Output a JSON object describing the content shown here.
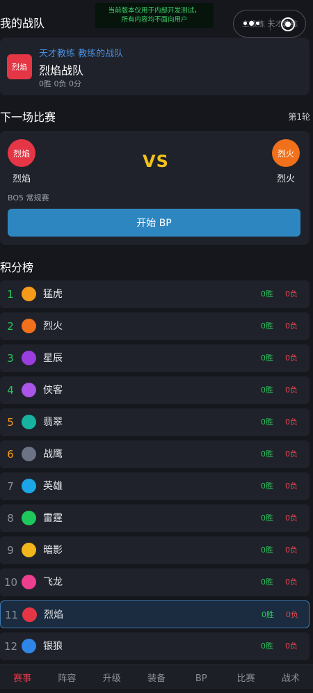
{
  "notice": {
    "line1": "当前版本仅用于内部开发测试，",
    "line2": "所有内容均不面向用户"
  },
  "capsule": {
    "tabs_text": "主教练 天才教练"
  },
  "my_team": {
    "section_title": "我的战队",
    "logo_text": "烈焰",
    "logo_color": "#e53646",
    "coach_line": "天才教练 教练的战队",
    "team_name": "烈焰战队",
    "stats": "0胜 0负 0分"
  },
  "next_match": {
    "section_title": "下一场比赛",
    "round": "第1轮",
    "home": {
      "badge": "烈焰",
      "name": "烈焰",
      "color": "#e53646"
    },
    "away": {
      "badge": "烈火",
      "name": "烈火",
      "color": "#f0701b"
    },
    "vs": "VS",
    "format": "BO5  常规赛",
    "start_button": "开始 BP"
  },
  "standings": {
    "section_title": "积分榜",
    "rows": [
      {
        "rank": "1",
        "rank_color": "#27c75a",
        "name": "猛虎",
        "color": "#f59a1b",
        "wins": "0胜",
        "losses": "0负"
      },
      {
        "rank": "2",
        "rank_color": "#27c75a",
        "name": "烈火",
        "color": "#f0701b",
        "wins": "0胜",
        "losses": "0负"
      },
      {
        "rank": "3",
        "rank_color": "#27c75a",
        "name": "星辰",
        "color": "#9b3ee0",
        "wins": "0胜",
        "losses": "0负"
      },
      {
        "rank": "4",
        "rank_color": "#27c75a",
        "name": "侠客",
        "color": "#a855e8",
        "wins": "0胜",
        "losses": "0负"
      },
      {
        "rank": "5",
        "rank_color": "#f59a1b",
        "name": "翡翠",
        "color": "#17b3a0",
        "wins": "0胜",
        "losses": "0负"
      },
      {
        "rank": "6",
        "rank_color": "#f59a1b",
        "name": "战鹰",
        "color": "#6b7385",
        "wins": "0胜",
        "losses": "0负"
      },
      {
        "rank": "7",
        "rank_color": "#8b8f98",
        "name": "英雄",
        "color": "#1ba6e8",
        "wins": "0胜",
        "losses": "0负"
      },
      {
        "rank": "8",
        "rank_color": "#8b8f98",
        "name": "雷霆",
        "color": "#1ec85c",
        "wins": "0胜",
        "losses": "0负"
      },
      {
        "rank": "9",
        "rank_color": "#8b8f98",
        "name": "暗影",
        "color": "#f2b51b",
        "wins": "0胜",
        "losses": "0负"
      },
      {
        "rank": "10",
        "rank_color": "#8b8f98",
        "name": "飞龙",
        "color": "#ee3f8f",
        "wins": "0胜",
        "losses": "0负"
      },
      {
        "rank": "11",
        "rank_color": "#8b8f98",
        "name": "烈焰",
        "color": "#e53646",
        "wins": "0胜",
        "losses": "0负",
        "highlight": true
      },
      {
        "rank": "12",
        "rank_color": "#8b8f98",
        "name": "银狼",
        "color": "#2e86e8",
        "wins": "0胜",
        "losses": "0负"
      }
    ]
  },
  "bottom_nav": {
    "active_color": "#e53646",
    "tabs": [
      "赛事",
      "阵容",
      "升级",
      "装备",
      "BP",
      "比赛",
      "战术"
    ],
    "active": "赛事"
  }
}
